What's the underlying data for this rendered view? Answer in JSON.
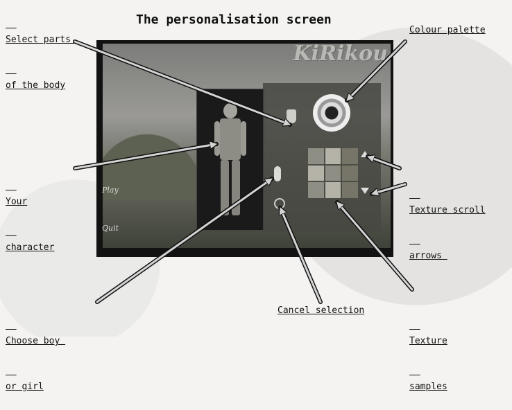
{
  "title": "The personalisation screen",
  "labels": {
    "select_parts_1": "Select parts ",
    "select_parts_2": "of the body",
    "colour_palette": "Colour palette",
    "your_character_1": "Your",
    "your_character_2": "character",
    "texture_scroll_1": "Texture scroll",
    "texture_scroll_2": "arrows ",
    "choose_boy_1": "Choose boy ",
    "choose_boy_2": "or girl",
    "cancel_selection": "Cancel selection",
    "texture_samples_1": "Texture",
    "texture_samples_2": "samples"
  },
  "screen": {
    "brand": "KiRikou",
    "menu": {
      "play": "Play",
      "quit": "Quit"
    }
  },
  "colors": {
    "arrow_fill": "#d4d4d4",
    "arrow_stroke": "#111111",
    "screen_bg": "#121212",
    "page_bg": "#f4f3f1"
  }
}
